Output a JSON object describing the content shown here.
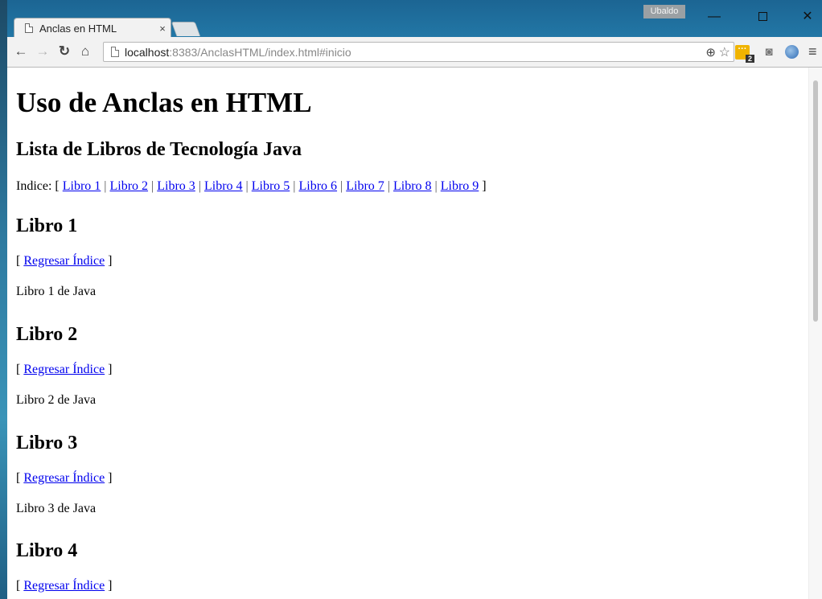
{
  "browser": {
    "tab_title": "Anclas en HTML",
    "tab_close": "×",
    "user_name": "Ubaldo",
    "url_host": "localhost",
    "url_rest": ":8383/AnclasHTML/index.html#inicio",
    "menu_icon": "≡"
  },
  "page": {
    "title": "Uso de Anclas en HTML",
    "subtitle": "Lista de Libros de Tecnología Java",
    "index_prefix": "Indice: [",
    "index_suffix": "]",
    "index_separator": "|",
    "index_links": [
      "Libro 1",
      "Libro 2",
      "Libro 3",
      "Libro 4",
      "Libro 5",
      "Libro 6",
      "Libro 7",
      "Libro 8",
      "Libro 9"
    ],
    "back_open": "[",
    "back_close": "]",
    "back_label": "Regresar Índice",
    "books": [
      {
        "title": "Libro 1",
        "text": "Libro 1 de Java"
      },
      {
        "title": "Libro 2",
        "text": "Libro 2 de Java"
      },
      {
        "title": "Libro 3",
        "text": "Libro 3 de Java"
      },
      {
        "title": "Libro 4",
        "text": ""
      }
    ]
  },
  "colors": {
    "link": "#0000ee",
    "titlebar": "#1f6b9b"
  }
}
